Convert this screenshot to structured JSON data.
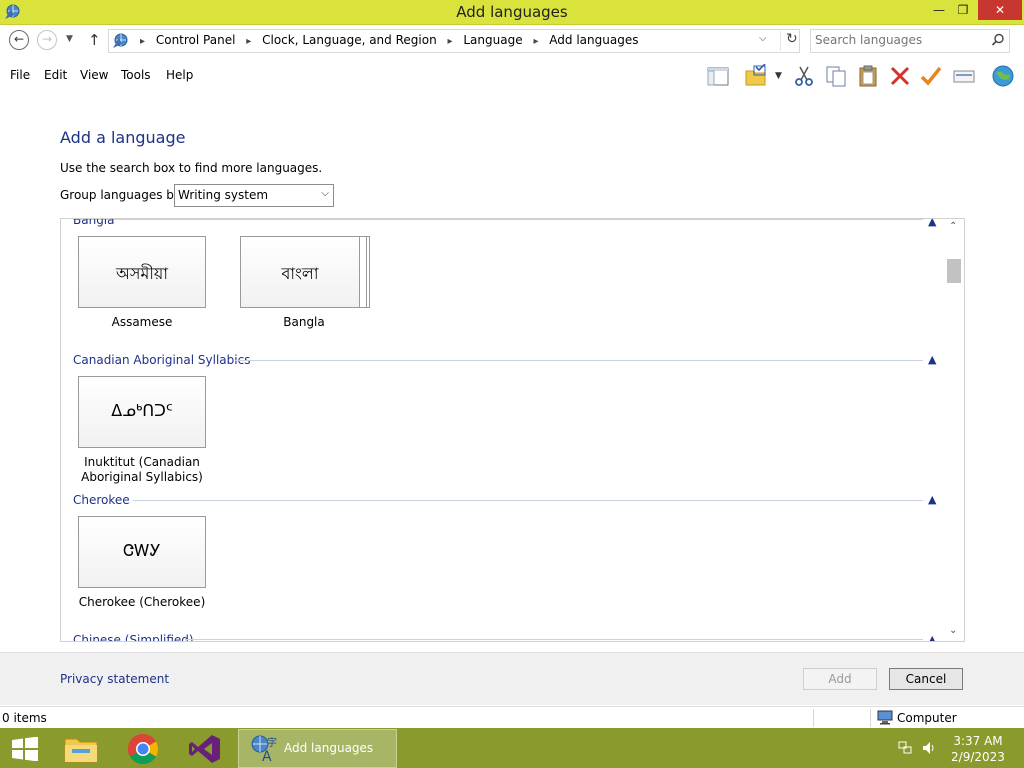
{
  "window": {
    "title": "Add languages"
  },
  "address": {
    "crumbs": [
      "Control Panel",
      "Clock, Language, and Region",
      "Language",
      "Add languages"
    ]
  },
  "search": {
    "placeholder": "Search languages"
  },
  "menu": [
    "File",
    "Edit",
    "View",
    "Tools",
    "Help"
  ],
  "toolbar_icons": [
    "layout-pane-icon",
    "folder-options-icon",
    "cut-icon",
    "copy-icon",
    "paste-icon",
    "delete-icon",
    "checkmark-icon",
    "properties-icon",
    "globe-icon"
  ],
  "page": {
    "heading": "Add a language",
    "hint": "Use the search box to find more languages.",
    "group_label": "Group languages by:",
    "group_value": "Writing system"
  },
  "groups": [
    {
      "name": "Bangla",
      "languages": [
        {
          "script": "অসমীয়া",
          "label": "Assamese"
        },
        {
          "script": "বাংলা",
          "label": "Bangla"
        }
      ]
    },
    {
      "name": "Canadian Aboriginal Syllabics",
      "languages": [
        {
          "script": "ᐃᓄᒃᑎᑐᑦ",
          "label": "Inuktitut (Canadian Aboriginal Syllabics)"
        }
      ]
    },
    {
      "name": "Cherokee",
      "languages": [
        {
          "script": "ᏣᎳᎩ",
          "label": "Cherokee (Cherokee)"
        }
      ]
    },
    {
      "name": "Chinese (Simplified)",
      "languages": []
    }
  ],
  "footer": {
    "privacy": "Privacy statement",
    "add": "Add",
    "cancel": "Cancel"
  },
  "status": {
    "items": "0 items",
    "location": "Computer"
  },
  "taskbar": {
    "active_label": "Add languages",
    "time": "3:37 AM",
    "date": "2/9/2023"
  },
  "colors": {
    "titlebar": "#d9e33c",
    "taskbar": "#8a9a2c",
    "link": "#1e3287",
    "close": "#c7372f"
  }
}
